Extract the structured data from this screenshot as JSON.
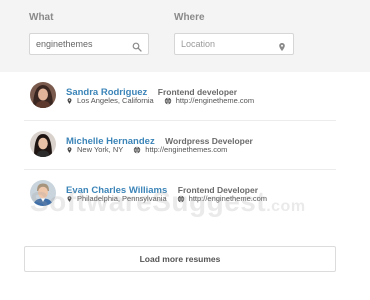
{
  "search": {
    "what_label": "What",
    "what_value": "enginethemes",
    "where_label": "Where",
    "where_placeholder": "Location"
  },
  "icons": {
    "search_field": "search-icon",
    "location_field": "map-pin-icon",
    "location_meta": "map-pin-icon",
    "website_meta": "globe-icon"
  },
  "resumes": [
    {
      "name": "Sandra Rodriguez",
      "title": "Frontend developer",
      "location": "Los Angeles, California",
      "url": "http://enginetheme.com"
    },
    {
      "name": "Michelle Hernandez",
      "title": "Wordpress Developer",
      "location": "New York, NY",
      "url": "http://enginethemes.com"
    },
    {
      "name": "Evan Charles Williams",
      "title": "Frontend Developer",
      "location": "Philadelphia, Pennsylvania",
      "url": "http://enginetheme.com"
    }
  ],
  "load_more_label": "Load more resumes",
  "watermark": {
    "brand": "SoftwareSuggest",
    "suffix": ".com"
  },
  "colors": {
    "name_link": "#3b84b8",
    "panel_bg": "#f4f4f4"
  }
}
